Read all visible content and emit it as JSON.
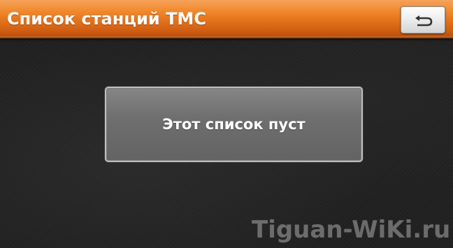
{
  "header": {
    "title": "Список станций TMC",
    "back_icon": "back-return-icon"
  },
  "main": {
    "empty_message": "Этот список пуст"
  },
  "watermark": {
    "text": "Tiguan-WiKi.ru"
  },
  "colors": {
    "header_orange": "#e4711a",
    "button_gray": "#6f6f6f",
    "background": "#222222"
  }
}
